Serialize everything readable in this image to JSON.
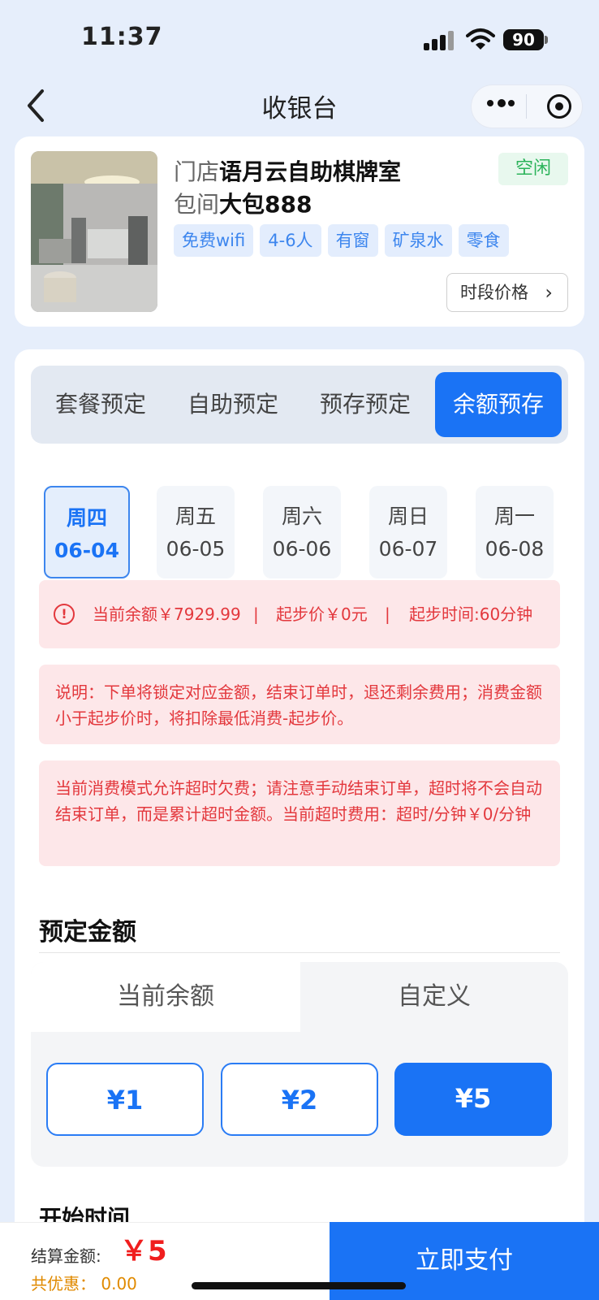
{
  "status_bar": {
    "time": "11:37",
    "battery": "90"
  },
  "nav": {
    "title": "收银台"
  },
  "store": {
    "store_prefix": "门店",
    "store_name": "语月云自助棋牌室",
    "room_prefix": "包间",
    "room_name": "大包888",
    "status": "空闲",
    "tags": [
      "免费wifi",
      "4-6人",
      "有窗",
      "矿泉水",
      "零食"
    ],
    "price_button": "时段价格",
    "colors": {
      "status": "#2bb35a",
      "tag_text": "#3d86ee",
      "tag_bg": "#e3edfd"
    }
  },
  "mode_tabs": {
    "items": [
      "套餐预定",
      "自助预定",
      "预存预定",
      "余额预存"
    ],
    "active_index": 3
  },
  "days": [
    {
      "weekday": "周四",
      "date": "06-04",
      "active": true
    },
    {
      "weekday": "周五",
      "date": "06-05",
      "active": false
    },
    {
      "weekday": "周六",
      "date": "06-06",
      "active": false
    },
    {
      "weekday": "周日",
      "date": "06-07",
      "active": false
    },
    {
      "weekday": "周一",
      "date": "06-08",
      "active": false
    }
  ],
  "notices": {
    "balance": "当前余额￥7929.99",
    "sep1": "|",
    "start_price": "起步价￥0元",
    "sep2": "|",
    "start_time": "起步时间:60分钟",
    "explain": "说明：下单将锁定对应金额，结束订单时，退还剩余费用；消费金额小于起步价时，将扣除最低消费-起步价。",
    "overtime": "当前消费模式允许超时欠费；请注意手动结束订单，超时将不会自动结束订单，而是累计超时金额。当前超时费用：超时/分钟￥0/分钟"
  },
  "amount_section": {
    "title": "预定金额",
    "segments": [
      "当前余额",
      "自定义"
    ],
    "options": [
      "¥1",
      "¥2",
      "¥5"
    ],
    "selected_index": 2
  },
  "start_section": {
    "title": "开始时间"
  },
  "bottom": {
    "settle_label": "结算金额:",
    "settle_amount": "￥5",
    "discount": "共优惠：  0.00",
    "pay_button": "立即支付"
  },
  "colors": {
    "primary": "#1a73f5",
    "alert_bg": "#fde7e9",
    "alert_text": "#e3383d",
    "page_bg": "#e6eefb"
  }
}
